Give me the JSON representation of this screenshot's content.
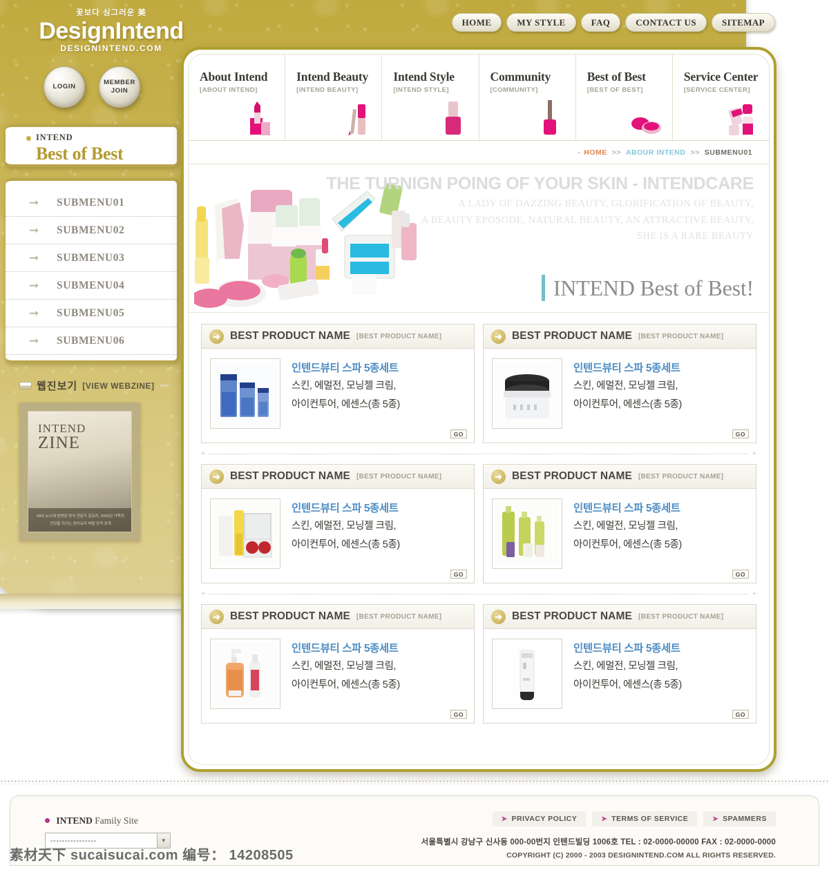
{
  "brand": {
    "tagline": "꽃보다 싱그러운 美",
    "name": "DesignIntend",
    "url": "DESIGNINTEND.COM"
  },
  "topnav": {
    "items": [
      {
        "label": "HOME"
      },
      {
        "label": "MY STYLE"
      },
      {
        "label": "FAQ"
      },
      {
        "label": "CONTACT US"
      },
      {
        "label": "SITEMAP"
      }
    ]
  },
  "auth": {
    "login_label": "LOGIN",
    "member_join_label": "MEMBER\nJOIN",
    "member_join_line1": "MEMBER",
    "member_join_line2": "JOIN"
  },
  "left_panel": {
    "kicker": "INTEND",
    "heading": "Best of Best",
    "submenu": [
      {
        "label": "SUBMENU01"
      },
      {
        "label": "SUBMENU02"
      },
      {
        "label": "SUBMENU03"
      },
      {
        "label": "SUBMENU04"
      },
      {
        "label": "SUBMENU05"
      },
      {
        "label": "SUBMENU06"
      }
    ]
  },
  "webzine": {
    "title_ko": "웹진보기",
    "title_en": "[VIEW WEBZINE]",
    "chevrons": "▸▸▸",
    "cover_line1": "INTEND",
    "cover_line2": "ZINE",
    "cover_caption": "KBS 뉴스에 방영된 양식 전문가 집요리, 2003년 가족의 건강을 지키는 양식요리 비법 전격 공개"
  },
  "main_menu": [
    {
      "title": "About Intend",
      "sub": "[ABOUT INTEND]",
      "icon": "lipstick-icon"
    },
    {
      "title": "Intend Beauty",
      "sub": "[INTEND BEAUTY]",
      "icon": "lipgloss-icon"
    },
    {
      "title": "Intend Style",
      "sub": "[INTEND STYLE]",
      "icon": "nailpolish-icon"
    },
    {
      "title": "Community",
      "sub": "[COMMUNITY]",
      "icon": "brush-icon"
    },
    {
      "title": "Best of Best",
      "sub": "[BEST OF BEST]",
      "icon": "compact-icon"
    },
    {
      "title": "Service Center",
      "sub": "[SERVICE CENTER]",
      "icon": "bottles-icon"
    }
  ],
  "breadcrumb": {
    "home": "HOME",
    "sep": ">>",
    "middle": "ABOUR INTEND",
    "current": "SUBMENU01"
  },
  "banner": {
    "headline_faded": "THE TURNIGN POING OF YOUR SKIN - INTENDCARE",
    "sub_line1": "A LADY OF DAZZING BEAUTY, GLORIFICATION OF BEAUTY,",
    "sub_line2": "A BEAUTY EPOSODE, NATURAL BEAUTY, AN ATTRACTIVE BEAUTY,",
    "sub_line3": "SHE IS A RARE BEAUTY",
    "headline": "INTEND Best of Best!"
  },
  "products": [
    {
      "head_title": "BEST PRODUCT NAME",
      "head_sub": "[BEST PRODUCT NAME]",
      "name": "인텐드뷰티 스파 5종세트",
      "desc_line1": "스킨, 에멀전, 모닝젤 크림,",
      "desc_line2": "아이컨투어, 에센스(총 5종)",
      "go_label": "GO",
      "thumb": "blue-toner-bottles"
    },
    {
      "head_title": "BEST PRODUCT NAME",
      "head_sub": "[BEST PRODUCT NAME]",
      "name": "인텐드뷰티 스파 5종세트",
      "desc_line1": "스킨, 에멀전, 모닝젤 크림,",
      "desc_line2": "아이컨투어, 에센스(총 5종)",
      "go_label": "GO",
      "thumb": "black-lid-cream-jar"
    },
    {
      "head_title": "BEST PRODUCT NAME",
      "head_sub": "[BEST PRODUCT NAME]",
      "name": "인텐드뷰티 스파 5종세트",
      "desc_line1": "스킨, 에멀전, 모닝젤 크림,",
      "desc_line2": "아이컨투어, 에센스(총 5종)",
      "go_label": "GO",
      "thumb": "yellow-bottle-red-palette"
    },
    {
      "head_title": "BEST PRODUCT NAME",
      "head_sub": "[BEST PRODUCT NAME]",
      "name": "인텐드뷰티 스파 5종세트",
      "desc_line1": "스킨, 에멀전, 모닝젤 크림,",
      "desc_line2": "아이컨투어, 에센스(총 5종)",
      "go_label": "GO",
      "thumb": "green-bottle-set"
    },
    {
      "head_title": "BEST PRODUCT NAME",
      "head_sub": "[BEST PRODUCT NAME]",
      "name": "인텐드뷰티 스파 5종세트",
      "desc_line1": "스킨, 에멀전, 모닝젤 크림,",
      "desc_line2": "아이컨투어, 에센스(총 5종)",
      "go_label": "GO",
      "thumb": "orange-pump-bottle"
    },
    {
      "head_title": "BEST PRODUCT NAME",
      "head_sub": "[BEST PRODUCT NAME]",
      "name": "인텐드뷰티 스파 5종세트",
      "desc_line1": "스킨, 에멀전, 모닝젤 크림,",
      "desc_line2": "아이컨투어, 에센스(총 5종)",
      "go_label": "GO",
      "thumb": "white-tube"
    }
  ],
  "footer": {
    "family_site_bold": "INTEND",
    "family_site_rest": " Family Site",
    "select_value": "----------------",
    "links": [
      {
        "label": "PRIVACY POLICY"
      },
      {
        "label": "TERMS OF SERVICE"
      },
      {
        "label": "SPAMMERS"
      }
    ],
    "address": "서울특별시  강남구 신사동 000-00번지 인텐드빌딩 1006호  TEL : 02-0000-00000  FAX : 02-0000-0000",
    "copyright": "COPYRIGHT (C) 2000 - 2003 DESIGNINTEND.COM  ALL RIGHTS RESERVED."
  },
  "watermark": {
    "text": "素材天下 sucaisucai.com  编号： 14208505"
  },
  "colors": {
    "gold": "#bfa93c",
    "gold_border": "#ada02f",
    "heading_gold": "#b39a31",
    "product_name_blue": "#4f8ec4",
    "breadcrumb_home": "#e08650",
    "breadcrumb_mid": "#83c7dd",
    "accent_bar": "#74bdc9",
    "pink": "#e0136c",
    "footer_dot": "#b3338d"
  }
}
